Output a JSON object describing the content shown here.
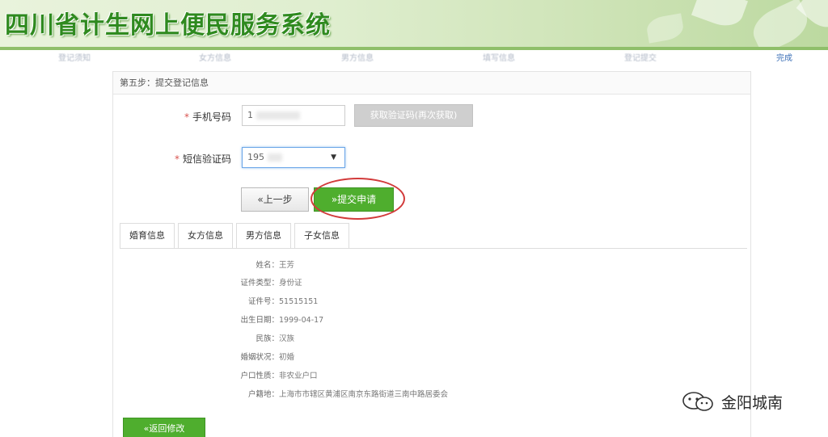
{
  "header": {
    "title": "四川省计生网上便民服务系统"
  },
  "steps": [
    {
      "label": "登记须知",
      "active": false
    },
    {
      "label": "女方信息",
      "active": false
    },
    {
      "label": "男方信息",
      "active": false
    },
    {
      "label": "填写信息",
      "active": false
    },
    {
      "label": "登记提交",
      "active": false
    },
    {
      "label": "完成",
      "active": true
    }
  ],
  "panel": {
    "heading": "第五步：提交登记信息"
  },
  "form": {
    "required_mark": "*",
    "phone_label": "手机号码",
    "phone_value": "1",
    "get_code_label": "获取验证码(再次获取)",
    "sms_label": "短信验证码",
    "sms_value": "195",
    "prev_button": "«上一步",
    "submit_button": "»提交申请"
  },
  "tabs": [
    {
      "label": "婚育信息",
      "active": false
    },
    {
      "label": "女方信息",
      "active": true
    },
    {
      "label": "男方信息",
      "active": false
    },
    {
      "label": "子女信息",
      "active": false
    }
  ],
  "info": [
    {
      "key": "姓名：",
      "value": "王芳"
    },
    {
      "key": "证件类型：",
      "value": "身份证"
    },
    {
      "key": "证件号：",
      "value": "51515151"
    },
    {
      "key": "出生日期：",
      "value": "1999-04-17"
    },
    {
      "key": "民族：",
      "value": "汉族"
    },
    {
      "key": "婚姻状况：",
      "value": "初婚"
    },
    {
      "key": "户口性质：",
      "value": "非农业户口"
    },
    {
      "key": "户籍地：",
      "value": "上海市市辖区黄浦区南京东路街道三南中路居委会"
    }
  ],
  "back_button": "«返回修改",
  "watermark": {
    "text": "金阳城南"
  },
  "colors": {
    "brand_green": "#4fae2e",
    "title_green": "#2f8a1f",
    "highlight_red": "#d23b3b",
    "active_step_blue": "#3b6fb6"
  }
}
